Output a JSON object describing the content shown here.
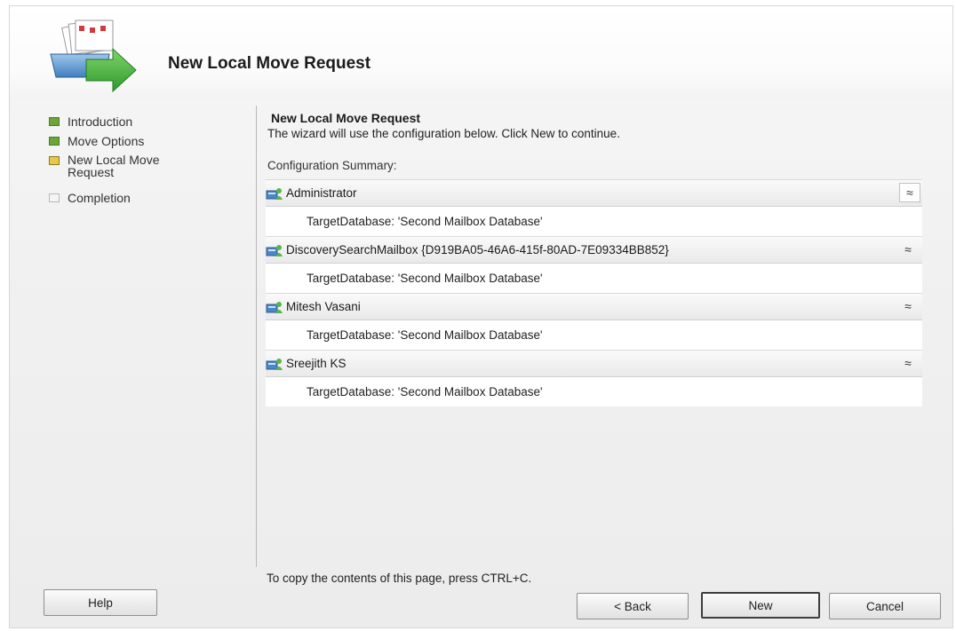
{
  "wizard": {
    "title": "New Local Move Request"
  },
  "steps": [
    {
      "label": "Introduction",
      "state": "done"
    },
    {
      "label": "Move Options",
      "state": "done"
    },
    {
      "label": "New Local Move Request",
      "state": "current"
    },
    {
      "label": "Completion",
      "state": "pending"
    }
  ],
  "content": {
    "title": "New Local Move Request",
    "subtitle": "The wizard will use the configuration below.  Click New to continue.",
    "summary_label": "Configuration Summary:"
  },
  "summary_items": [
    {
      "name": "Administrator",
      "detail": "TargetDatabase: 'Second Mailbox Database'"
    },
    {
      "name": "DiscoverySearchMailbox {D919BA05-46A6-415f-80AD-7E09334BB852}",
      "detail": "TargetDatabase: 'Second Mailbox Database'"
    },
    {
      "name": "Mitesh Vasani",
      "detail": "TargetDatabase: 'Second Mailbox Database'"
    },
    {
      "name": "Sreejith KS",
      "detail": "TargetDatabase: 'Second Mailbox Database'"
    }
  ],
  "collapse_glyph": "≈",
  "footer": {
    "copy_hint": "To copy the contents of this page, press CTRL+C."
  },
  "buttons": {
    "help": "Help",
    "back": "< Back",
    "new": "New",
    "cancel": "Cancel"
  },
  "icons": {
    "wizard": "move-mailbox-wizard-icon",
    "mailbox": "mailbox-user-icon",
    "collapse": "collapse-chevrons-icon"
  }
}
